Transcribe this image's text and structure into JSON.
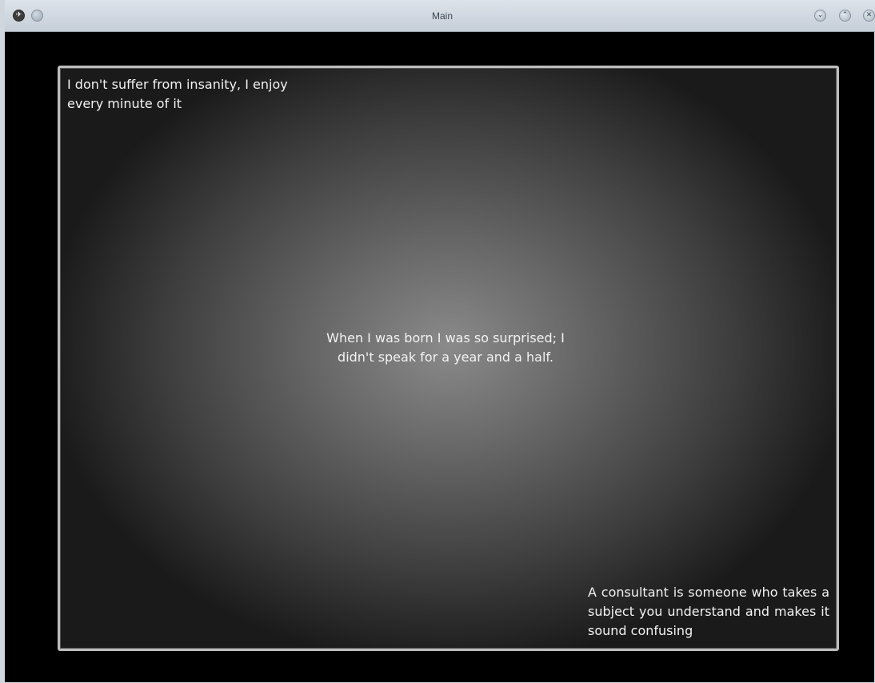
{
  "window": {
    "title": "Main"
  },
  "titlebar": {
    "app_menu_icon": "app-menu-icon",
    "pin_icon": "pin-icon",
    "minimize_icon": "chevron-down-icon",
    "maximize_icon": "chevron-up-icon",
    "close_icon": "close-icon"
  },
  "quotes": {
    "top_left": "I don't suffer from insanity, I enjoy every minute of it",
    "center": "When I was born I was so surprised; I didn't speak for a year and a half.",
    "bottom_right": "A consultant is someone who takes a subject you understand and makes it sound confusing"
  },
  "colors": {
    "text": "#f2f2f2",
    "border": "#bdbdbd",
    "background": "#000000"
  }
}
